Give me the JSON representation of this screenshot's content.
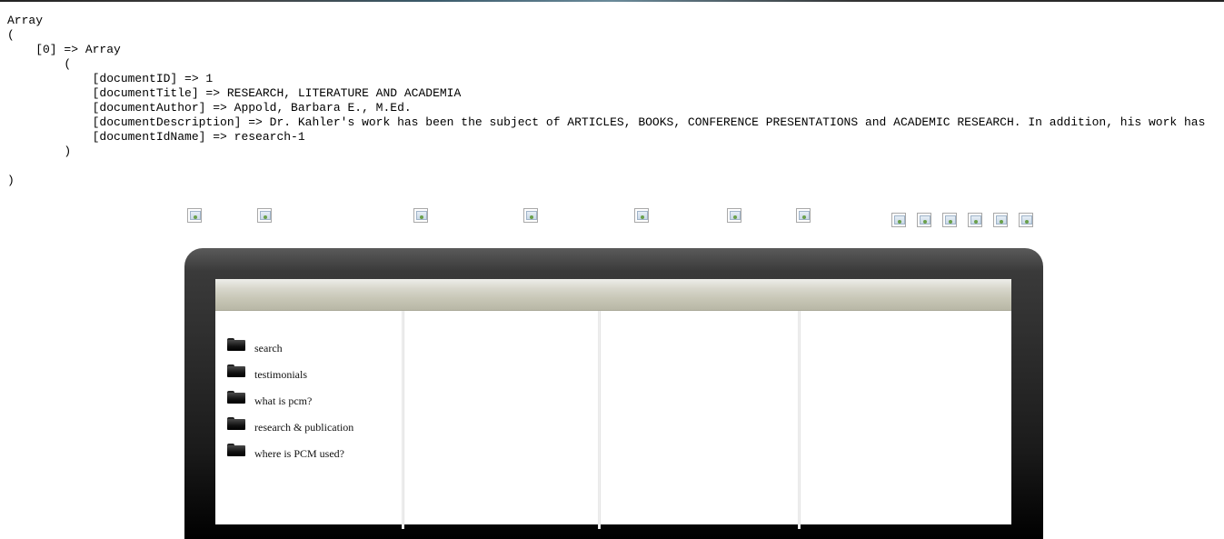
{
  "debug_output": "Array\n(\n    [0] => Array\n        (\n            [documentID] => 1\n            [documentTitle] => RESEARCH, LITERATURE AND ACADEMIA\n            [documentAuthor] => Appold, Barbara E., M.Ed.\n            [documentDescription] => Dr. Kahler's work has been the subject of ARTICLES, BOOKS, CONFERENCE PRESENTATIONS and ACADEMIC RESEARCH. In addition, his work has\n            [documentIdName] => research-1\n        )\n\n)",
  "nav_images": [
    "broken-image-icon",
    "broken-image-icon",
    "broken-image-icon",
    "broken-image-icon",
    "broken-image-icon",
    "broken-image-icon",
    "broken-image-icon"
  ],
  "social_images": [
    "broken-image-icon",
    "broken-image-icon",
    "broken-image-icon",
    "broken-image-icon",
    "broken-image-icon",
    "broken-image-icon"
  ],
  "menu": {
    "icon": "folder-icon",
    "items": [
      {
        "label": "search"
      },
      {
        "label": "testimonials"
      },
      {
        "label": "what is pcm?"
      },
      {
        "label": "research & publication"
      },
      {
        "label": "where is PCM used?"
      }
    ]
  },
  "colors": {
    "monitor_frame": "#1a1a1a",
    "screen_bar": "#c9c8b8",
    "text": "#111111"
  }
}
